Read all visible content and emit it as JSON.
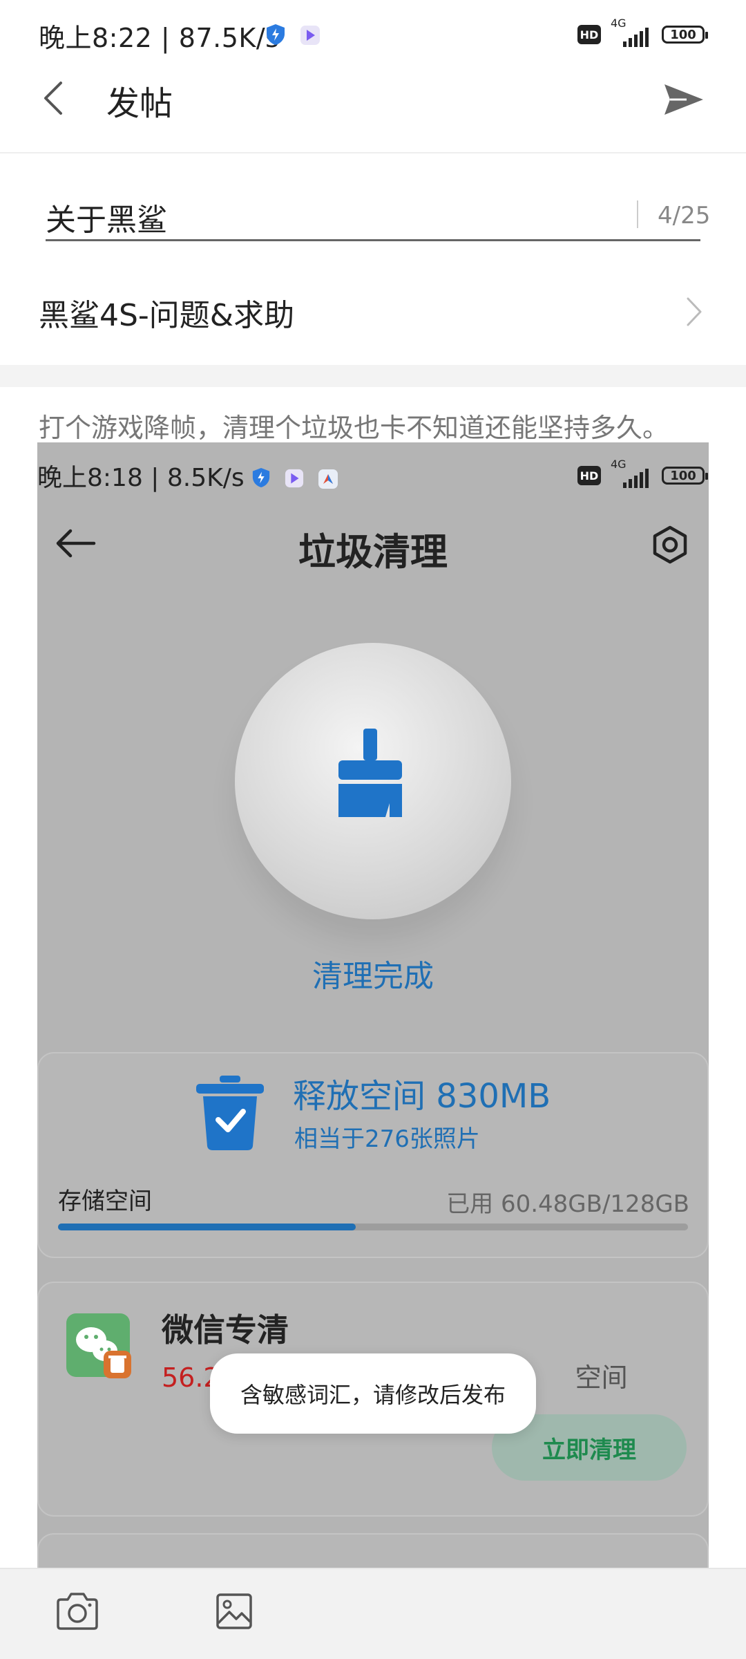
{
  "status_bar": {
    "time_speed": "晚上8:22 | 87.5K/s",
    "hd": "HD",
    "network": "4G",
    "battery": "100"
  },
  "header": {
    "title": "发帖",
    "back_icon": "back-arrow-icon",
    "send_icon": "send-icon"
  },
  "post": {
    "title_value": "关于黑鲨",
    "title_counter": "4/25",
    "category": "黑鲨4S-问题&求助",
    "body_text": "打个游戏降帧，清理个垃圾也卡不知道还能坚持多久。"
  },
  "embedded_screenshot": {
    "status": "晚上8:18 | 8.5K/s",
    "hd": "HD",
    "network": "4G",
    "battery": "100",
    "title": "垃圾清理",
    "done_label": "清理完成",
    "freed_label": "释放空间 830MB",
    "freed_sub": "相当于276张照片",
    "storage_label": "存储空间",
    "storage_value": "已用 60.48GB/128GB",
    "storage_used_fraction": 0.4725,
    "wechat_title": "微信专清",
    "wechat_desc_red": "56.2",
    "wechat_desc_gray": "空间",
    "clean_button": "立即清理",
    "colors": {
      "accent_blue": "#1f6fb4",
      "wechat_green": "#1e8a4e",
      "warn_red": "#c42020"
    }
  },
  "toast": {
    "message": "含敏感词汇，请修改后发布"
  },
  "toolbar": {
    "camera_icon": "camera-icon",
    "image_icon": "image-icon"
  }
}
